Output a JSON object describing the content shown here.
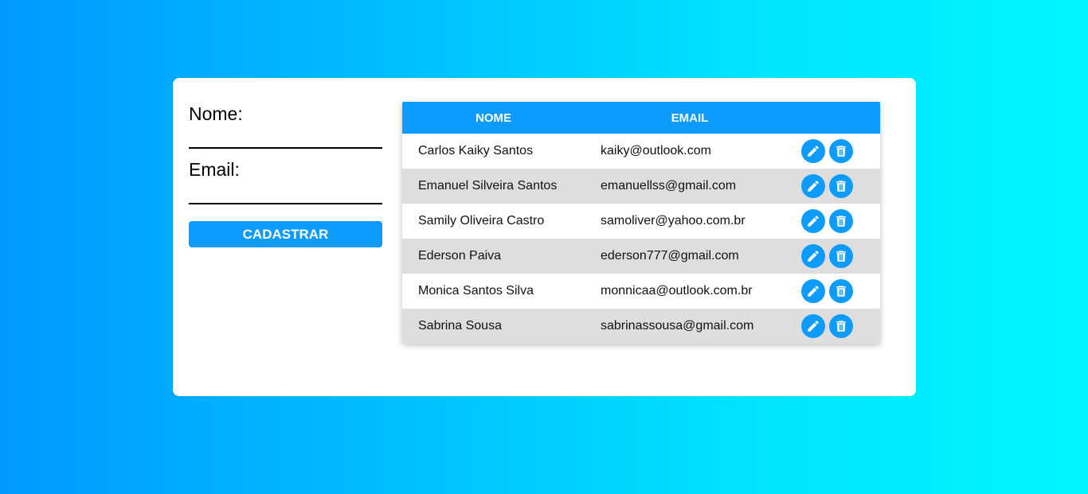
{
  "form": {
    "name_label": "Nome:",
    "name_value": "",
    "email_label": "Email:",
    "email_value": "",
    "submit_label": "CADASTRAR"
  },
  "table": {
    "headers": {
      "name": "NOME",
      "email": "EMAIL",
      "actions": ""
    },
    "rows": [
      {
        "name": "Carlos Kaiky Santos",
        "email": "kaiky@outlook.com"
      },
      {
        "name": "Emanuel Silveira Santos",
        "email": "emanuellss@gmail.com"
      },
      {
        "name": "Samily Oliveira Castro",
        "email": "samoliver@yahoo.com.br"
      },
      {
        "name": "Ederson Paiva",
        "email": "ederson777@gmail.com"
      },
      {
        "name": "Monica Santos Silva",
        "email": "monnicaa@outlook.com.br"
      },
      {
        "name": "Sabrina Sousa",
        "email": "sabrinassousa@gmail.com"
      }
    ],
    "row_actions": {
      "edit_icon": "pencil-icon",
      "delete_icon": "trash-icon"
    }
  },
  "colors": {
    "accent": "#0d9bff",
    "background_start": "#0199ff",
    "background_end": "#00f6ff",
    "row_alt": "#dedede"
  }
}
